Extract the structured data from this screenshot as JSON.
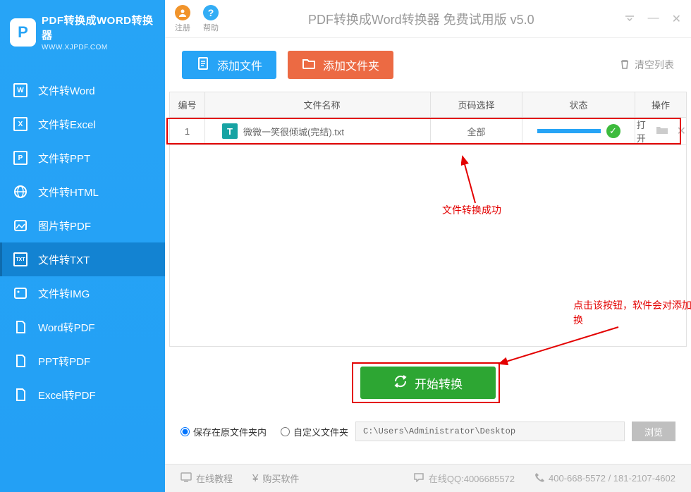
{
  "brand": {
    "title": "PDF转换成WORD转换器",
    "subtitle": "WWW.XJPDF.COM",
    "logo_letter": "P"
  },
  "sidebar": {
    "items": [
      {
        "icon": "W",
        "label": "文件转Word"
      },
      {
        "icon": "X",
        "label": "文件转Excel"
      },
      {
        "icon": "P",
        "label": "文件转PPT"
      },
      {
        "icon": "globe",
        "label": "文件转HTML"
      },
      {
        "icon": "img",
        "label": "图片转PDF"
      },
      {
        "icon": "TXT",
        "label": "文件转TXT",
        "active": true
      },
      {
        "icon": "pic",
        "label": "文件转IMG"
      },
      {
        "icon": "pdf",
        "label": "Word转PDF"
      },
      {
        "icon": "pdf",
        "label": "PPT转PDF"
      },
      {
        "icon": "pdf",
        "label": "Excel转PDF"
      }
    ]
  },
  "titlebar": {
    "register": "注册",
    "help": "帮助",
    "app_title": "PDF转换成Word转换器 免费试用版 v5.0"
  },
  "toolbar": {
    "add_file": "添加文件",
    "add_folder": "添加文件夹",
    "clear_list": "清空列表"
  },
  "table": {
    "headers": {
      "num": "编号",
      "name": "文件名称",
      "page": "页码选择",
      "status": "状态",
      "action": "操作"
    },
    "rows": [
      {
        "num": "1",
        "icon": "T",
        "name": "微微一笑很倾城(完结).txt",
        "page": "全部",
        "status_complete": true,
        "open_label": "打开"
      }
    ]
  },
  "annotations": {
    "success": "文件转换成功",
    "start_hint": "点击该按钮，软件会对添加的文件进行一键转换"
  },
  "convert": {
    "label": "开始转换"
  },
  "save": {
    "opt_same": "保存在原文件夹内",
    "opt_custom": "自定义文件夹",
    "path": "C:\\Users\\Administrator\\Desktop",
    "browse": "浏览"
  },
  "statusbar": {
    "tutorial": "在线教程",
    "buy": "购买软件",
    "qq": "在线QQ:4006685572",
    "phone": "400-668-5572 / 181-2107-4602"
  }
}
